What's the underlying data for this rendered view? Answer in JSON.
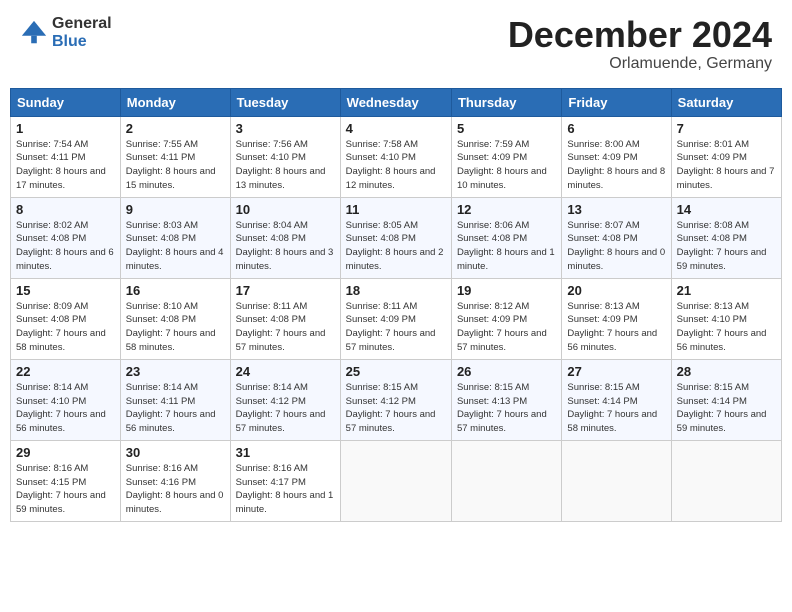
{
  "header": {
    "logo_general": "General",
    "logo_blue": "Blue",
    "month_title": "December 2024",
    "location": "Orlamuende, Germany"
  },
  "calendar": {
    "days_of_week": [
      "Sunday",
      "Monday",
      "Tuesday",
      "Wednesday",
      "Thursday",
      "Friday",
      "Saturday"
    ],
    "weeks": [
      [
        {
          "day": "1",
          "info": "Sunrise: 7:54 AM\nSunset: 4:11 PM\nDaylight: 8 hours and 17 minutes."
        },
        {
          "day": "2",
          "info": "Sunrise: 7:55 AM\nSunset: 4:11 PM\nDaylight: 8 hours and 15 minutes."
        },
        {
          "day": "3",
          "info": "Sunrise: 7:56 AM\nSunset: 4:10 PM\nDaylight: 8 hours and 13 minutes."
        },
        {
          "day": "4",
          "info": "Sunrise: 7:58 AM\nSunset: 4:10 PM\nDaylight: 8 hours and 12 minutes."
        },
        {
          "day": "5",
          "info": "Sunrise: 7:59 AM\nSunset: 4:09 PM\nDaylight: 8 hours and 10 minutes."
        },
        {
          "day": "6",
          "info": "Sunrise: 8:00 AM\nSunset: 4:09 PM\nDaylight: 8 hours and 8 minutes."
        },
        {
          "day": "7",
          "info": "Sunrise: 8:01 AM\nSunset: 4:09 PM\nDaylight: 8 hours and 7 minutes."
        }
      ],
      [
        {
          "day": "8",
          "info": "Sunrise: 8:02 AM\nSunset: 4:08 PM\nDaylight: 8 hours and 6 minutes."
        },
        {
          "day": "9",
          "info": "Sunrise: 8:03 AM\nSunset: 4:08 PM\nDaylight: 8 hours and 4 minutes."
        },
        {
          "day": "10",
          "info": "Sunrise: 8:04 AM\nSunset: 4:08 PM\nDaylight: 8 hours and 3 minutes."
        },
        {
          "day": "11",
          "info": "Sunrise: 8:05 AM\nSunset: 4:08 PM\nDaylight: 8 hours and 2 minutes."
        },
        {
          "day": "12",
          "info": "Sunrise: 8:06 AM\nSunset: 4:08 PM\nDaylight: 8 hours and 1 minute."
        },
        {
          "day": "13",
          "info": "Sunrise: 8:07 AM\nSunset: 4:08 PM\nDaylight: 8 hours and 0 minutes."
        },
        {
          "day": "14",
          "info": "Sunrise: 8:08 AM\nSunset: 4:08 PM\nDaylight: 7 hours and 59 minutes."
        }
      ],
      [
        {
          "day": "15",
          "info": "Sunrise: 8:09 AM\nSunset: 4:08 PM\nDaylight: 7 hours and 58 minutes."
        },
        {
          "day": "16",
          "info": "Sunrise: 8:10 AM\nSunset: 4:08 PM\nDaylight: 7 hours and 58 minutes."
        },
        {
          "day": "17",
          "info": "Sunrise: 8:11 AM\nSunset: 4:08 PM\nDaylight: 7 hours and 57 minutes."
        },
        {
          "day": "18",
          "info": "Sunrise: 8:11 AM\nSunset: 4:09 PM\nDaylight: 7 hours and 57 minutes."
        },
        {
          "day": "19",
          "info": "Sunrise: 8:12 AM\nSunset: 4:09 PM\nDaylight: 7 hours and 57 minutes."
        },
        {
          "day": "20",
          "info": "Sunrise: 8:13 AM\nSunset: 4:09 PM\nDaylight: 7 hours and 56 minutes."
        },
        {
          "day": "21",
          "info": "Sunrise: 8:13 AM\nSunset: 4:10 PM\nDaylight: 7 hours and 56 minutes."
        }
      ],
      [
        {
          "day": "22",
          "info": "Sunrise: 8:14 AM\nSunset: 4:10 PM\nDaylight: 7 hours and 56 minutes."
        },
        {
          "day": "23",
          "info": "Sunrise: 8:14 AM\nSunset: 4:11 PM\nDaylight: 7 hours and 56 minutes."
        },
        {
          "day": "24",
          "info": "Sunrise: 8:14 AM\nSunset: 4:12 PM\nDaylight: 7 hours and 57 minutes."
        },
        {
          "day": "25",
          "info": "Sunrise: 8:15 AM\nSunset: 4:12 PM\nDaylight: 7 hours and 57 minutes."
        },
        {
          "day": "26",
          "info": "Sunrise: 8:15 AM\nSunset: 4:13 PM\nDaylight: 7 hours and 57 minutes."
        },
        {
          "day": "27",
          "info": "Sunrise: 8:15 AM\nSunset: 4:14 PM\nDaylight: 7 hours and 58 minutes."
        },
        {
          "day": "28",
          "info": "Sunrise: 8:15 AM\nSunset: 4:14 PM\nDaylight: 7 hours and 59 minutes."
        }
      ],
      [
        {
          "day": "29",
          "info": "Sunrise: 8:16 AM\nSunset: 4:15 PM\nDaylight: 7 hours and 59 minutes."
        },
        {
          "day": "30",
          "info": "Sunrise: 8:16 AM\nSunset: 4:16 PM\nDaylight: 8 hours and 0 minutes."
        },
        {
          "day": "31",
          "info": "Sunrise: 8:16 AM\nSunset: 4:17 PM\nDaylight: 8 hours and 1 minute."
        },
        {
          "day": "",
          "info": ""
        },
        {
          "day": "",
          "info": ""
        },
        {
          "day": "",
          "info": ""
        },
        {
          "day": "",
          "info": ""
        }
      ]
    ]
  }
}
